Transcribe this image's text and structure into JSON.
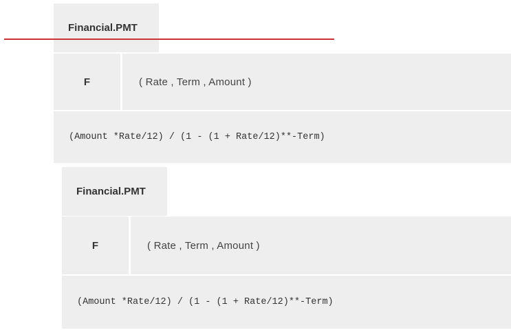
{
  "cards": [
    {
      "title": "Financial.PMT",
      "type_label": "F",
      "args": "( Rate , Term , Amount )",
      "formula": "(Amount *Rate/12) / (1 - (1 + Rate/12)**-Term)"
    },
    {
      "title": "Financial.PMT",
      "type_label": "F",
      "args": "( Rate , Term , Amount )",
      "formula": "(Amount *Rate/12) / (1 - (1 + Rate/12)**-Term)"
    }
  ],
  "colors": {
    "panel_bg": "#eeeeee",
    "accent_line": "#cc3333",
    "text": "#333333"
  }
}
